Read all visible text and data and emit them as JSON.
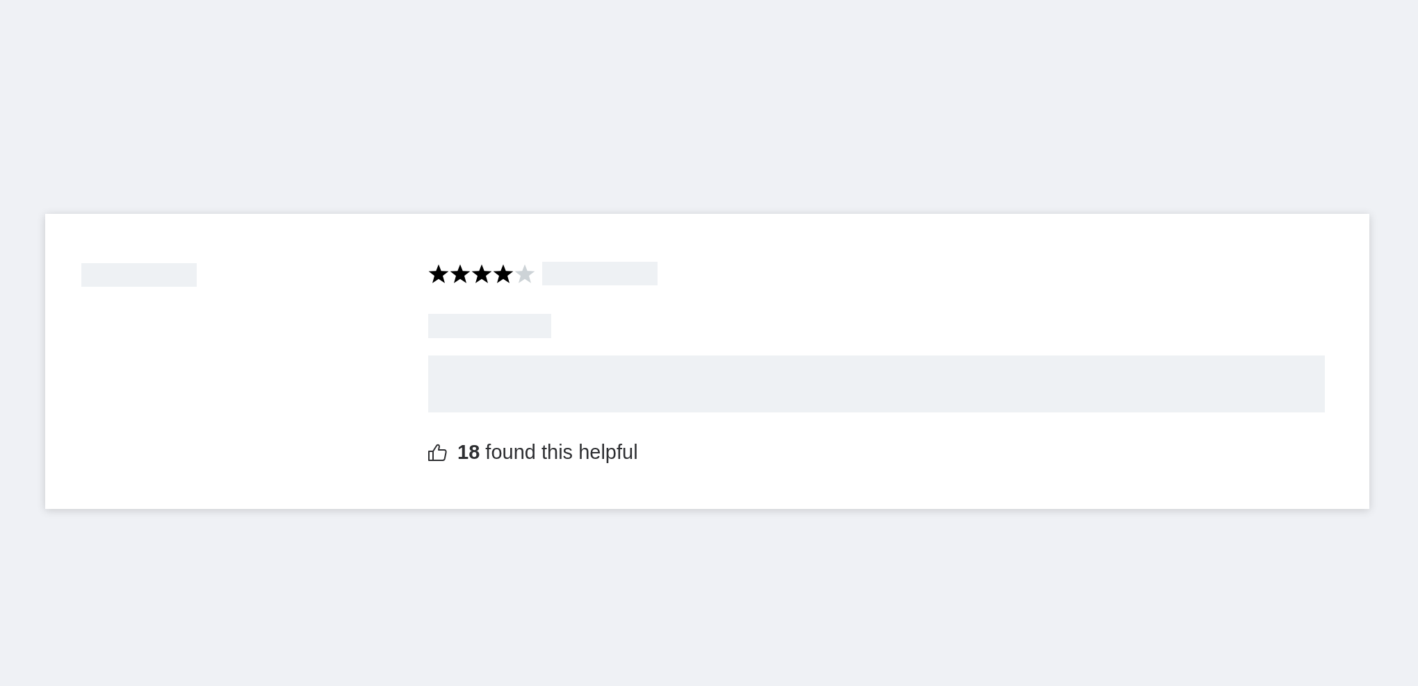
{
  "review": {
    "stars": 4,
    "helpful": "**18** found this helpful"
  }
}
